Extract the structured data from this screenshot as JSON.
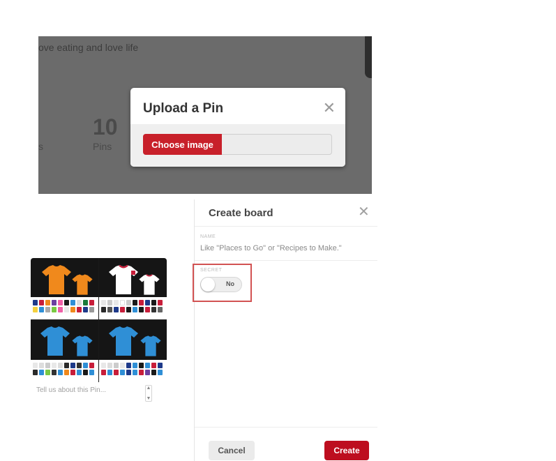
{
  "profile": {
    "tagline": "ove eating and love life",
    "stat_number": "10",
    "stat_label": "Pins",
    "stat_left_label": "s"
  },
  "upload_dialog": {
    "title": "Upload a Pin",
    "close_icon": "close-icon",
    "choose_button_label": "Choose image"
  },
  "pin_card": {
    "description_placeholder": "Tell us about this Pin...",
    "scroll_up": "▲",
    "scroll_down": "▼",
    "shirt_colors": [
      "#f0891c",
      "#ffffff",
      "#2f8fd6",
      "#2f8fd6"
    ]
  },
  "create_board": {
    "title": "Create board",
    "close_symbol": "✕",
    "name_label": "NAME",
    "name_placeholder": "Like \"Places to Go\" or \"Recipes to Make.\"",
    "secret_label": "SECRET",
    "secret_value": "No",
    "cancel_label": "Cancel",
    "create_label": "Create"
  },
  "colors": {
    "brand_red": "#bd0e1f",
    "highlight": "#d25252"
  }
}
